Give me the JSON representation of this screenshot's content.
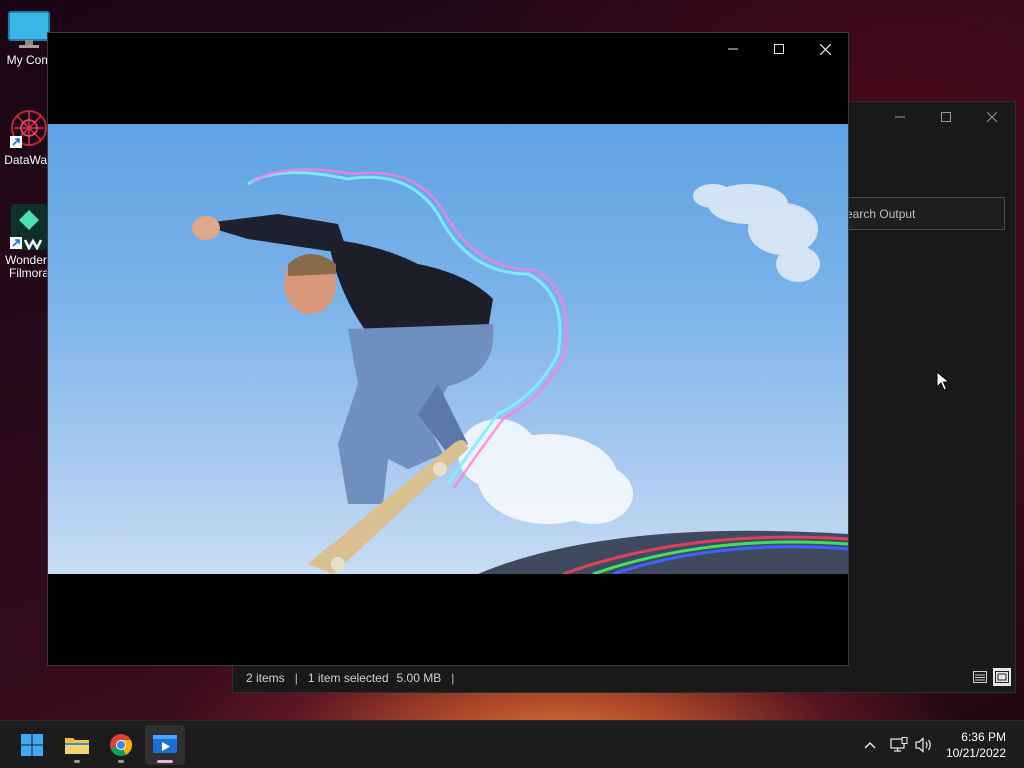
{
  "desktop": {
    "icons": [
      {
        "label": "My Com",
        "icon": "monitor-icon"
      },
      {
        "label": "DataWag",
        "icon": "datawag-app-icon"
      },
      {
        "label": "Wonders",
        "label2": "Filmora",
        "icon": "filmora-app-icon"
      }
    ]
  },
  "explorer": {
    "search_placeholder": "Search Output",
    "status": {
      "items": "2 items",
      "selected": "1 item selected",
      "size": "5.00 MB"
    }
  },
  "player": {
    "frame_description_icon": "video-frame"
  },
  "taskbar": {
    "apps": [
      "start-icon",
      "file-explorer-icon",
      "chrome-icon",
      "media-player-icon"
    ],
    "clock": {
      "time": "6:36 PM",
      "date": "10/21/2022"
    }
  }
}
